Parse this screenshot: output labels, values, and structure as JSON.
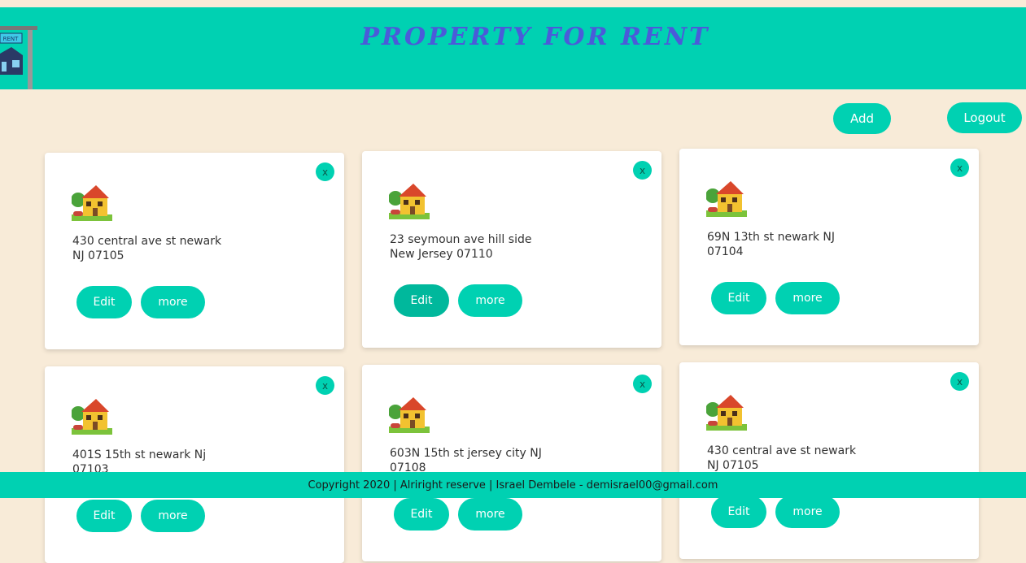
{
  "header": {
    "title": "PROPERTY FOR RENT",
    "logo_sign": "RENT"
  },
  "toolbar": {
    "add_label": "Add",
    "logout_label": "Logout"
  },
  "listings": [
    {
      "address_line1": "430 central ave st newark",
      "address_line2": "NJ 07105",
      "edit_label": "Edit",
      "more_label": "more",
      "close_label": "x"
    },
    {
      "address_line1": "23 seymoun ave hill side",
      "address_line2": "New Jersey 07110",
      "edit_label": "Edit",
      "more_label": "more",
      "close_label": "x"
    },
    {
      "address_line1": "69N 13th st newark NJ",
      "address_line2": "07104",
      "edit_label": "Edit",
      "more_label": "more",
      "close_label": "x"
    },
    {
      "address_line1": "401S 15th st newark Nj",
      "address_line2": "07103",
      "edit_label": "Edit",
      "more_label": "more",
      "close_label": "x"
    },
    {
      "address_line1": "603N 15th st jersey city NJ",
      "address_line2": "07108",
      "edit_label": "Edit",
      "more_label": "more",
      "close_label": "x"
    },
    {
      "address_line1": "430 central ave st newark",
      "address_line2": "NJ 07105",
      "edit_label": "Edit",
      "more_label": "more",
      "close_label": "x"
    }
  ],
  "footer": {
    "text": "Copyright 2020 | Alriright reserve | Israel Dembele - demisrael00@gmail.com"
  },
  "icons": {
    "house": "house-icon",
    "close": "close-icon",
    "logo": "rent-sign-logo"
  },
  "colors": {
    "accent": "#00d1b2",
    "background": "#f8ebd8",
    "title": "#4a5bd9"
  }
}
